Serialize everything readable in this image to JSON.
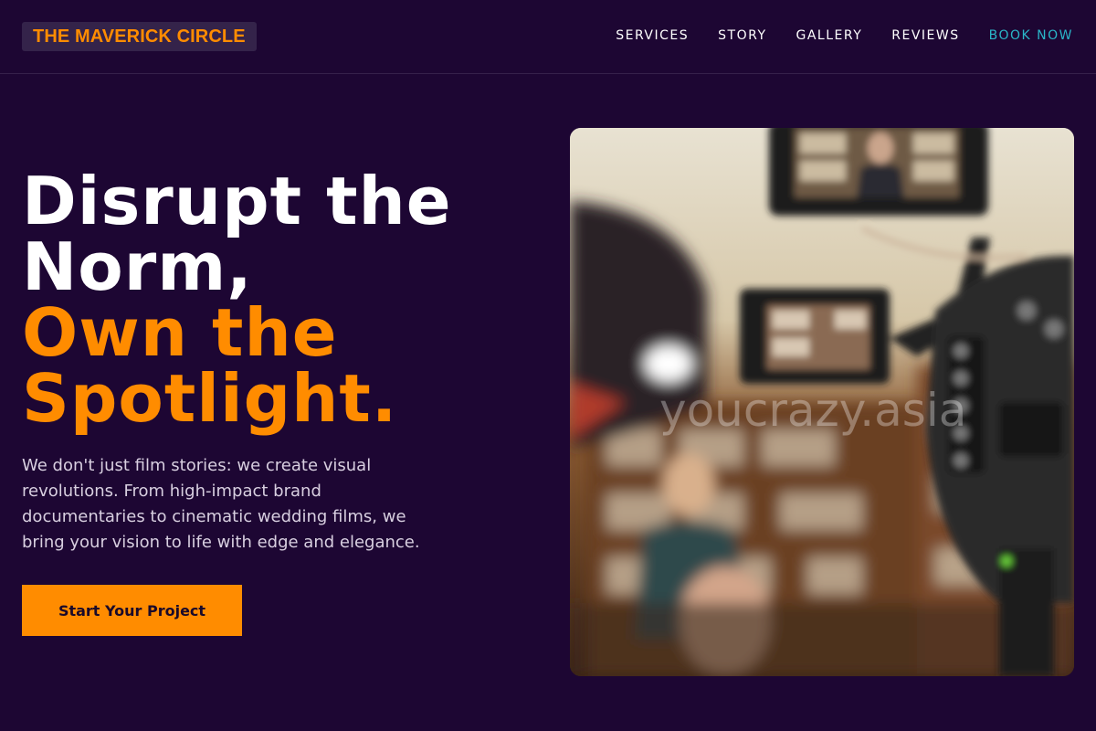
{
  "header": {
    "logo": "THE MAVERICK CIRCLE",
    "nav": [
      {
        "label": "SERVICES"
      },
      {
        "label": "STORY"
      },
      {
        "label": "GALLERY"
      },
      {
        "label": "REVIEWS"
      },
      {
        "label": "BOOK NOW"
      }
    ]
  },
  "hero": {
    "headline_line1": "Disrupt the",
    "headline_line2": "Norm,",
    "headline_accent1": "Own the",
    "headline_accent2": "Spotlight.",
    "lede": "We don't just film stories: we create visual revolutions. From high-impact brand documentaries to cinematic wedding films, we bring your vision to life with edge and elegance.",
    "cta_label": "Start Your Project",
    "image_watermark": "youcrazy.asia"
  },
  "colors": {
    "background": "#1d0633",
    "accent": "#ff8c00",
    "link_accent": "#2ab6c8"
  }
}
